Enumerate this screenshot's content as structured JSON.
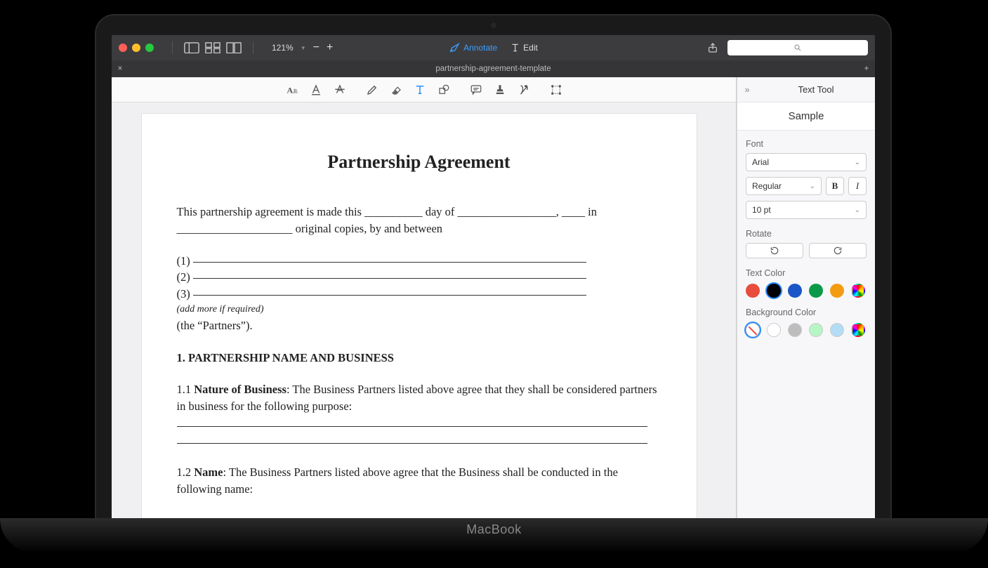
{
  "toolbar": {
    "zoom": "121%",
    "annotate": "Annotate",
    "edit": "Edit"
  },
  "tab": {
    "title": "partnership-agreement-template"
  },
  "doc": {
    "title": "Partnership Agreement",
    "intro1": "This partnership agreement is made this __________ day of _________________, ____ in",
    "intro2": "____________________ original copies, by and between",
    "line1": "(1)",
    "line2": "(2)",
    "line3": "(3)",
    "more": "(add more if required)",
    "partners": "(the “Partners”).",
    "h1": "1. PARTNERSHIP NAME AND BUSINESS",
    "s11a": "1.1 ",
    "s11b": "Nature of Business",
    "s11c": ": The Business Partners listed above agree that they shall be considered partners in business for the following purpose:",
    "s12a": "1.2 ",
    "s12b": "Name",
    "s12c": ": The Business Partners listed above agree that the Business shall be conducted in the following name:"
  },
  "panel": {
    "title": "Text Tool",
    "sample": "Sample",
    "fontLabel": "Font",
    "fontValue": "Arial",
    "weightValue": "Regular",
    "sizeValue": "10 pt",
    "bold": "B",
    "italic": "I",
    "rotateLabel": "Rotate",
    "textColorLabel": "Text Color",
    "bgColorLabel": "Background Color",
    "textColors": [
      "#e74c3c",
      "#000000",
      "#1a56c7",
      "#0b9a4a",
      "#f39c12"
    ],
    "textSelected": 1,
    "bgColors": [
      "none",
      "#ffffff",
      "#bdbdbd",
      "#b6f5c4",
      "#b3dcf5"
    ],
    "bgSelected": 0
  },
  "laptop": {
    "brand": "MacBook"
  }
}
